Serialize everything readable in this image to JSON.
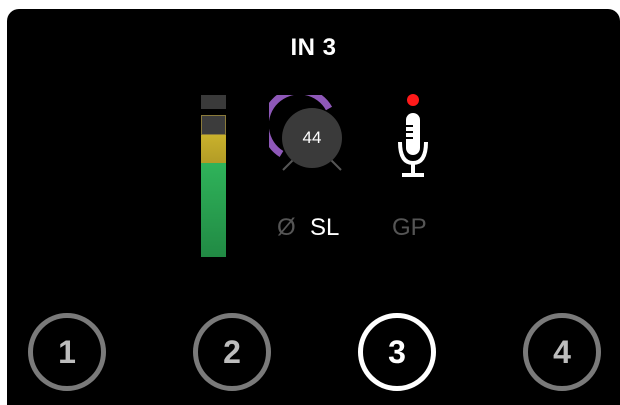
{
  "header": {
    "title": "IN 3"
  },
  "input_meter": {
    "peak_segment": "empty",
    "level_fraction": 0.85,
    "colors": {
      "green": "#2fb35a",
      "yellow": "#c9b12c",
      "empty": "#3c3c3c"
    }
  },
  "gain": {
    "value": "44",
    "arc_color": "#8e58b8"
  },
  "mic": {
    "icon": "microphone-icon",
    "phantom_power_indicator_color": "#ff1a1a"
  },
  "labels": {
    "phase_symbol": "Ø",
    "safe_label": "SL",
    "grip_label": "GP"
  },
  "channels": [
    {
      "label": "1",
      "active": false
    },
    {
      "label": "2",
      "active": false
    },
    {
      "label": "3",
      "active": true
    },
    {
      "label": "4",
      "active": false
    }
  ]
}
